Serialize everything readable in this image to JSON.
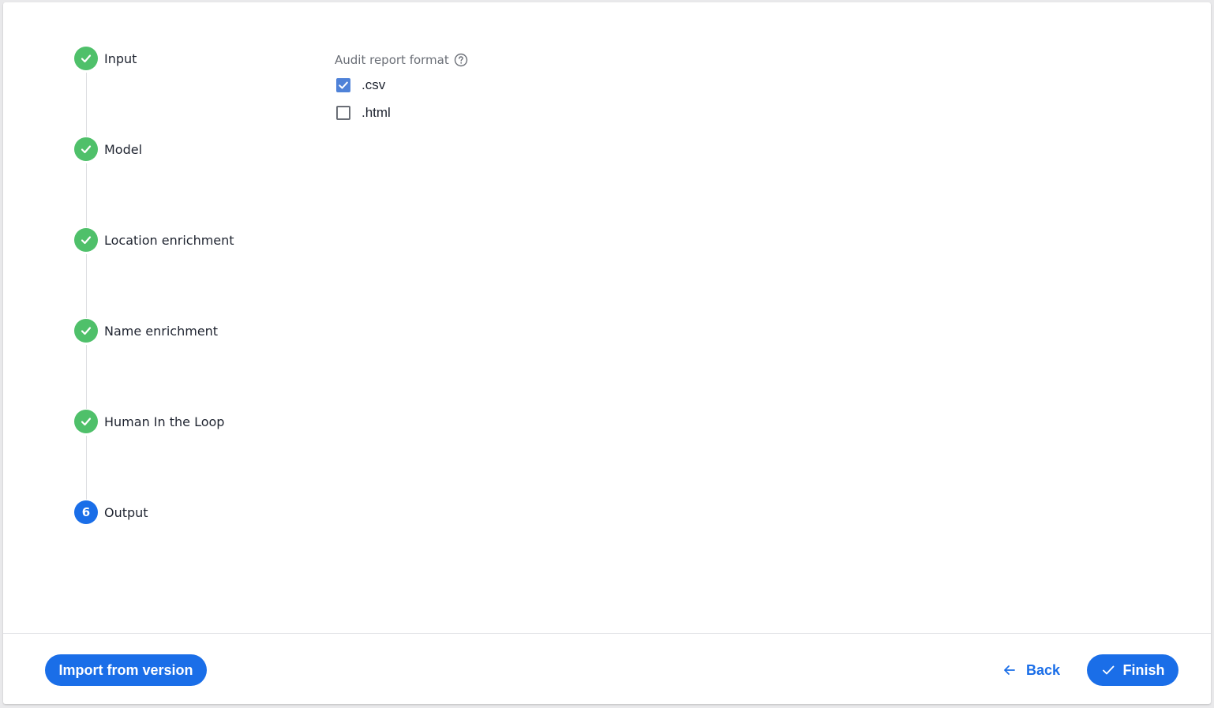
{
  "stepper": {
    "steps": [
      {
        "label": "Input",
        "state": "done"
      },
      {
        "label": "Model",
        "state": "done"
      },
      {
        "label": "Location enrichment",
        "state": "done"
      },
      {
        "label": "Name enrichment",
        "state": "done"
      },
      {
        "label": "Human In the Loop",
        "state": "done"
      },
      {
        "label": "Output",
        "state": "active",
        "number": "6"
      }
    ]
  },
  "output_form": {
    "audit_report_label": "Audit report format",
    "options": [
      {
        "label": ".csv",
        "checked": true
      },
      {
        "label": ".html",
        "checked": false
      }
    ]
  },
  "footer": {
    "import_label": "Import from version",
    "back_label": "Back",
    "finish_label": "Finish"
  },
  "colors": {
    "primary": "#1a6ee8",
    "success": "#4fc06a",
    "checkbox_checked": "#4f82d8"
  },
  "icons": {
    "step_done": "check-icon",
    "help": "help-circle-icon",
    "back": "arrow-left-icon",
    "finish": "check-icon"
  }
}
